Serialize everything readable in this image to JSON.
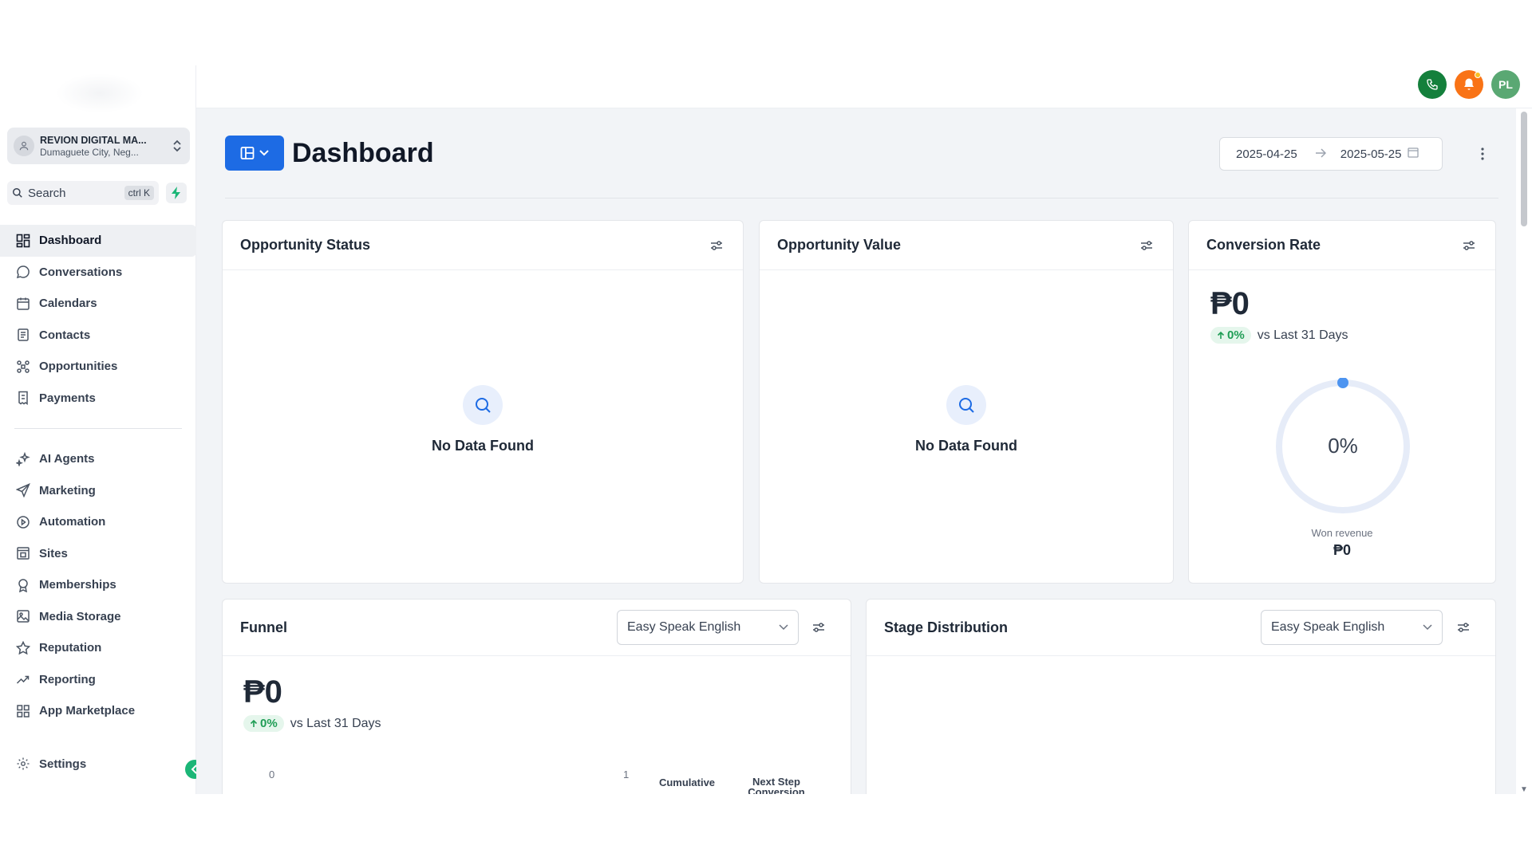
{
  "account": {
    "name": "REVION DIGITAL MA...",
    "location": "Dumaguete City, Neg..."
  },
  "search": {
    "label": "Search",
    "shortcut": "ctrl K"
  },
  "nav": {
    "primary": [
      {
        "label": "Dashboard",
        "icon": "grid-icon",
        "active": true
      },
      {
        "label": "Conversations",
        "icon": "chat-bubble-icon"
      },
      {
        "label": "Calendars",
        "icon": "calendar-icon"
      },
      {
        "label": "Contacts",
        "icon": "address-book-icon"
      },
      {
        "label": "Opportunities",
        "icon": "pipeline-icon"
      },
      {
        "label": "Payments",
        "icon": "invoice-icon"
      }
    ],
    "secondary": [
      {
        "label": "AI Agents",
        "icon": "sparkle-icon"
      },
      {
        "label": "Marketing",
        "icon": "send-icon"
      },
      {
        "label": "Automation",
        "icon": "automation-icon"
      },
      {
        "label": "Sites",
        "icon": "site-icon"
      },
      {
        "label": "Memberships",
        "icon": "badge-icon"
      },
      {
        "label": "Media Storage",
        "icon": "image-icon"
      },
      {
        "label": "Reputation",
        "icon": "star-icon"
      },
      {
        "label": "Reporting",
        "icon": "trend-icon"
      },
      {
        "label": "App Marketplace",
        "icon": "apps-icon"
      }
    ],
    "settings": "Settings"
  },
  "header": {
    "avatar_initials": "PL"
  },
  "page": {
    "title": "Dashboard"
  },
  "date_range": {
    "start": "2025-04-25",
    "end": "2025-05-25"
  },
  "cards": {
    "opportunity_status": {
      "title": "Opportunity Status",
      "empty": "No Data Found"
    },
    "opportunity_value": {
      "title": "Opportunity Value",
      "empty": "No Data Found"
    },
    "conversion_rate": {
      "title": "Conversion Rate",
      "amount": "₱0",
      "change": "0%",
      "comparison": "vs Last 31 Days",
      "gauge_value": "0%",
      "gauge_fraction": 0,
      "won_label": "Won revenue",
      "won_amount": "₱0"
    },
    "funnel": {
      "title": "Funnel",
      "pipeline": "Easy Speak English",
      "amount": "₱0",
      "change": "0%",
      "comparison": "vs Last 31 Days",
      "axis_start": "0",
      "axis_end": "1",
      "col_cumulative": "Cumulative",
      "col_next_line1": "Next Step",
      "col_next_line2": "Conversion"
    },
    "stage_distribution": {
      "title": "Stage Distribution",
      "pipeline": "Easy Speak English"
    }
  },
  "colors": {
    "primary": "#1d6be4",
    "success": "#1bb677",
    "phone": "#14803c",
    "bell": "#f97316",
    "avatar": "#5aa873"
  }
}
